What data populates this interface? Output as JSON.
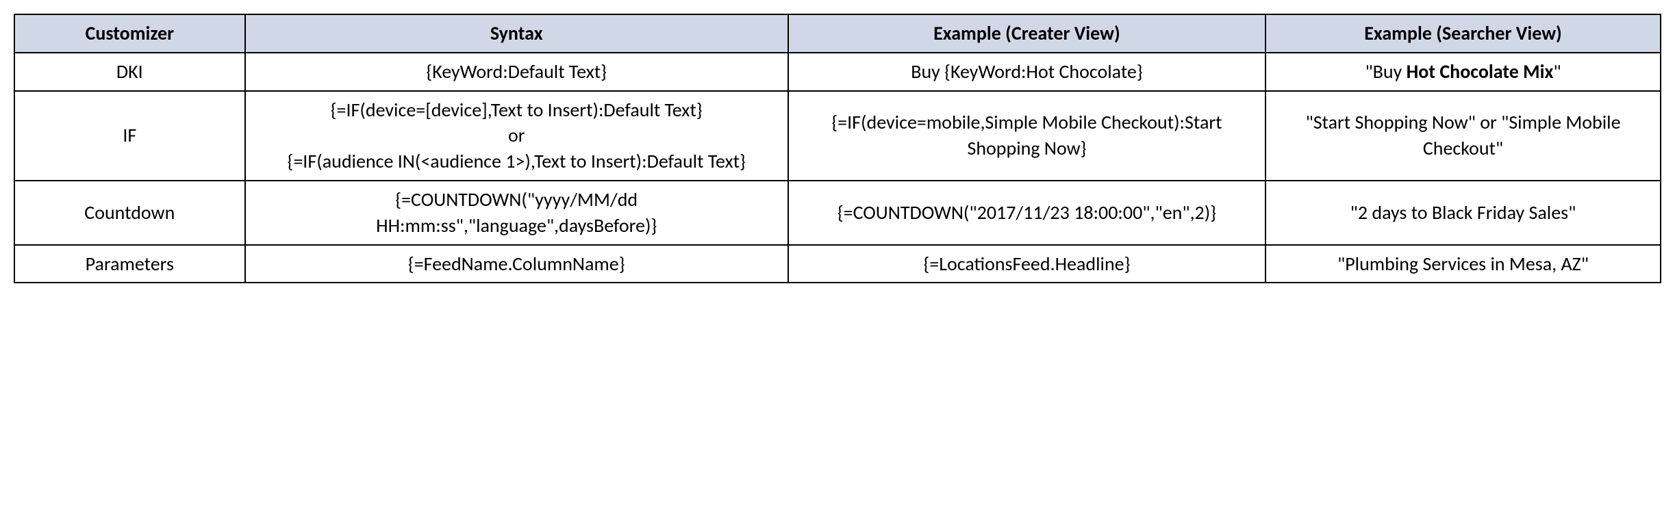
{
  "table": {
    "headers": {
      "customizer": "Customizer",
      "syntax": "Syntax",
      "creater": "Example (Creater View)",
      "searcher": "Example (Searcher View)"
    },
    "rows": [
      {
        "customizer": "DKI",
        "syntax": "{KeyWord:Default Text}",
        "creater": "Buy {KeyWord:Hot Chocolate}",
        "searcher_prefix": "\"Buy ",
        "searcher_bold": "Hot Chocolate Mix",
        "searcher_suffix": "\""
      },
      {
        "customizer": "IF",
        "syntax_line1": "{=IF(device=[device],Text to Insert):Default Text}",
        "syntax_line2": "or",
        "syntax_line3": "{=IF(audience IN(<audience 1>),Text to Insert):Default Text}",
        "creater": "{=IF(device=mobile,Simple Mobile Checkout):Start Shopping Now}",
        "searcher": "\"Start Shopping Now\" or \"Simple Mobile Checkout\""
      },
      {
        "customizer": "Countdown",
        "syntax": "{=COUNTDOWN(\"yyyy/MM/dd HH:mm:ss\",\"language\",daysBefore)}",
        "creater": "{=COUNTDOWN(\"2017/11/23 18:00:00\",\"en\",2)}",
        "searcher": "\"2 days to Black Friday Sales\""
      },
      {
        "customizer": "Parameters",
        "syntax": "{=FeedName.ColumnName}",
        "creater": "{=LocationsFeed.Headline}",
        "searcher": "\"Plumbing Services in Mesa, AZ\""
      }
    ]
  }
}
